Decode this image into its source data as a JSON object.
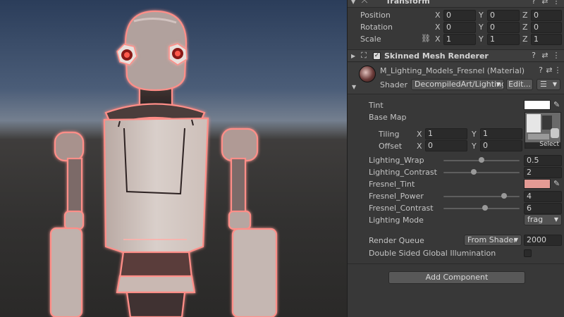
{
  "transform": {
    "title": "Transform",
    "rows": [
      {
        "label": "Position",
        "x": "0",
        "y": "0",
        "z": "0"
      },
      {
        "label": "Rotation",
        "x": "0",
        "y": "0",
        "z": "0"
      },
      {
        "label": "Scale",
        "x": "1",
        "y": "1",
        "z": "1"
      }
    ],
    "axis": {
      "x": "X",
      "y": "Y",
      "z": "Z"
    }
  },
  "skinned": {
    "title": "Skinned Mesh Renderer",
    "enabled": true
  },
  "material": {
    "name": "M_Lighting_Models_Fresnel (Material)",
    "shader_label": "Shader",
    "shader_value": "DecompiledArt/Lighting/",
    "edit_label": "Edit...",
    "menu_icon": "list-icon"
  },
  "props": {
    "tint": {
      "label": "Tint",
      "color": "#ffffff"
    },
    "base_map": {
      "label": "Base Map",
      "select_label": "Select"
    },
    "tiling": {
      "label": "Tiling",
      "x": "1",
      "y": "1"
    },
    "offset": {
      "label": "Offset",
      "x": "0",
      "y": "0"
    },
    "lighting_wrap": {
      "label": "Lighting_Wrap",
      "value": "0.5",
      "fraction": 0.5
    },
    "lighting_contrast": {
      "label": "Lighting_Contrast",
      "value": "2",
      "fraction": 0.4
    },
    "fresnel_tint": {
      "label": "Fresnel_Tint",
      "color": "#e39a94"
    },
    "fresnel_power": {
      "label": "Fresnel_Power",
      "value": "4",
      "fraction": 0.8
    },
    "fresnel_contrast": {
      "label": "Fresnel_Contrast",
      "value": "6",
      "fraction": 0.55
    },
    "lighting_mode": {
      "label": "Lighting Mode",
      "value": "frag"
    },
    "render_queue": {
      "label": "Render Queue",
      "mode": "From Shader",
      "value": "2000"
    },
    "double_sided": {
      "label": "Double Sided Global Illumination",
      "checked": false
    }
  },
  "add_component": "Add Component",
  "colors": {
    "inspector_bg": "#383838",
    "field_bg": "#2a2a2a",
    "rim_glow": "#ff9a94"
  }
}
